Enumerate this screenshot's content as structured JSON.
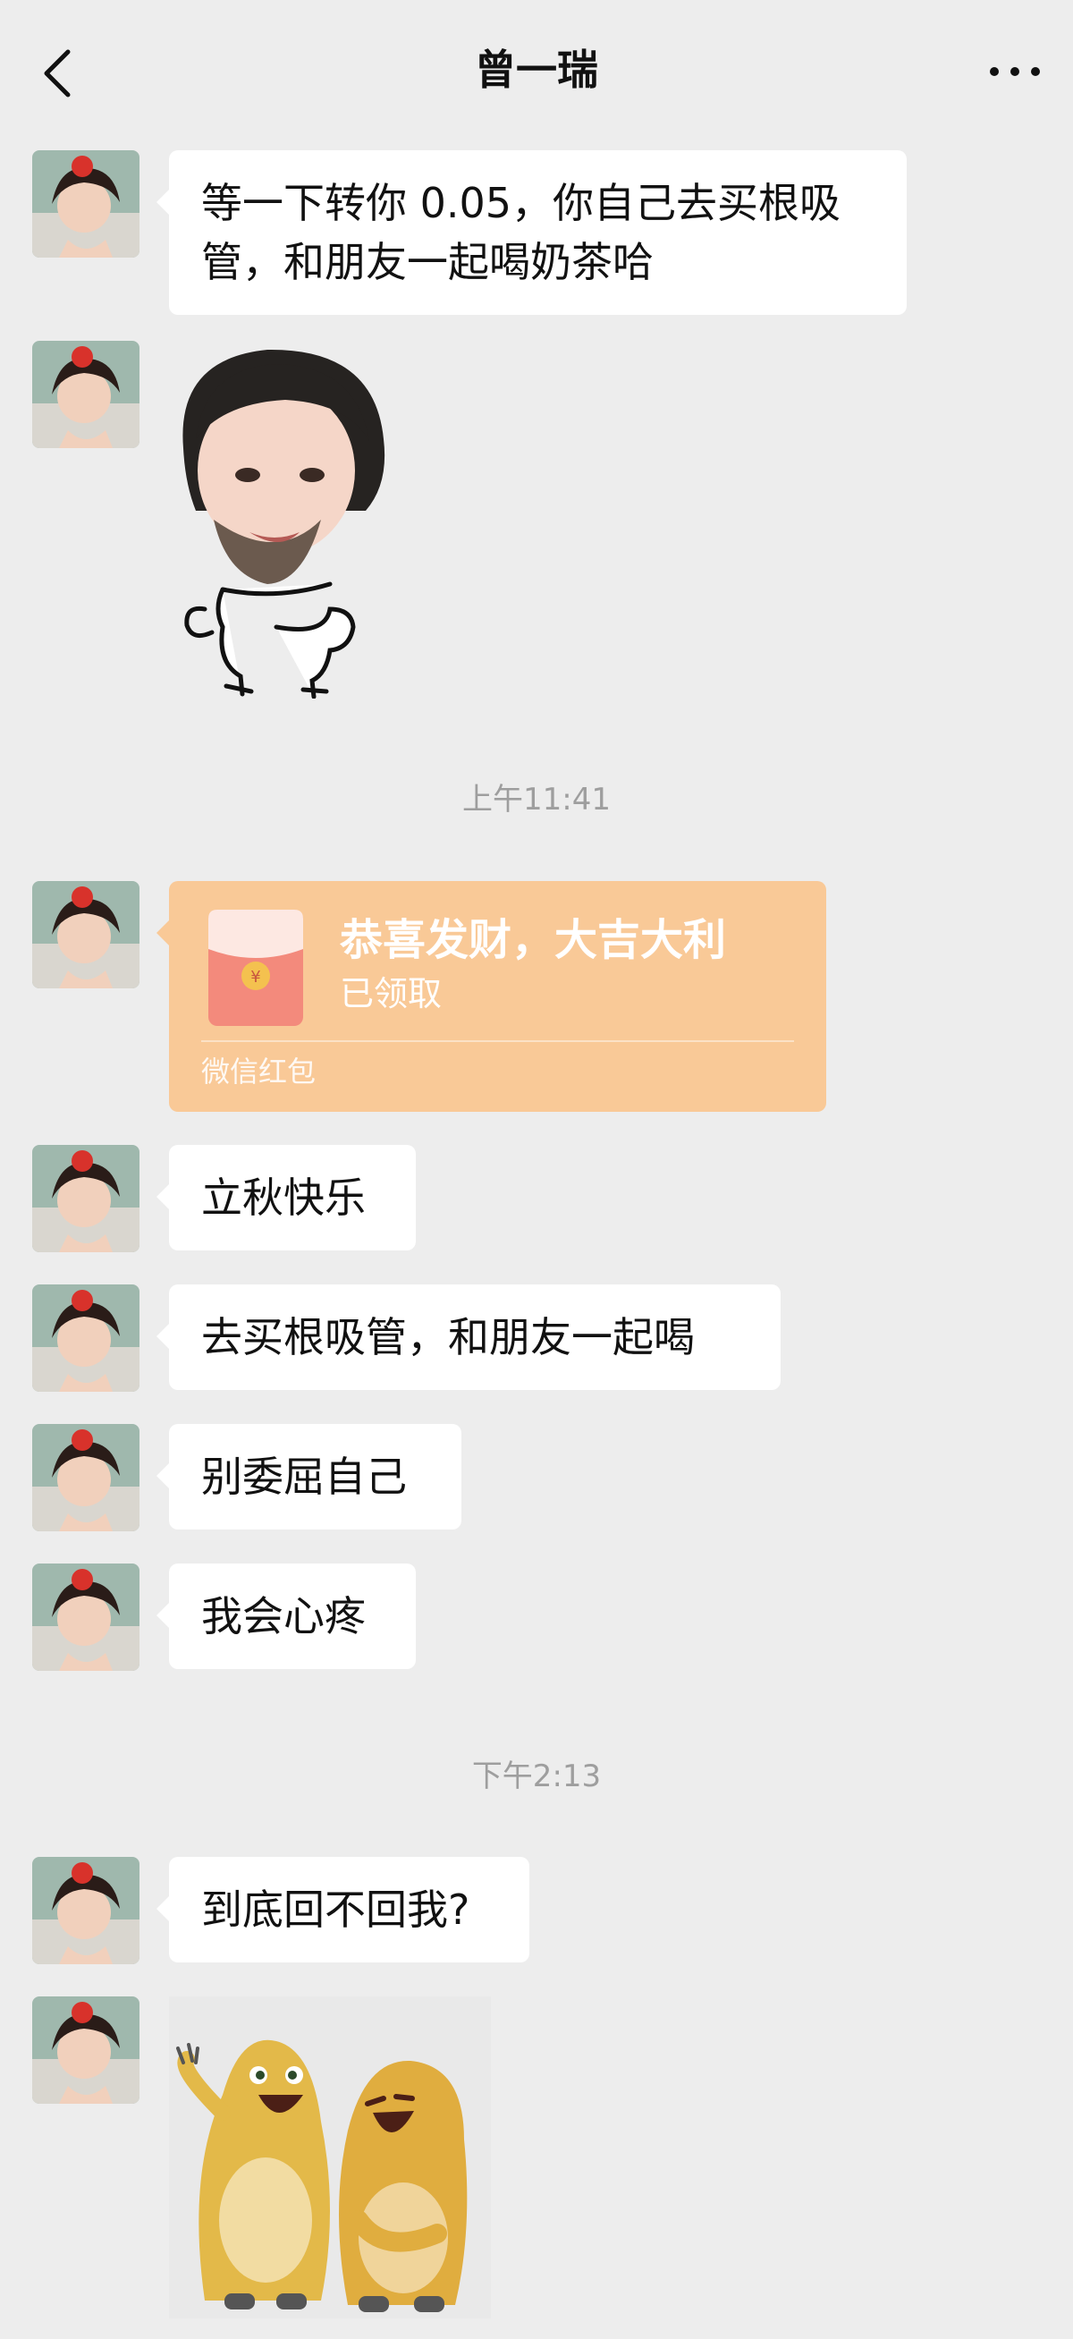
{
  "header": {
    "title": "曾一瑞",
    "back_icon": "chevron-left-icon",
    "more_icon": "more-horizontal-icon"
  },
  "messages": [
    {
      "type": "text",
      "text": "等一下转你 0.05，你自己去买根吸\n管，和朋友一起喝奶茶哈"
    },
    {
      "type": "sticker",
      "description_icon": "man-face-sticker-icon"
    },
    {
      "type": "time",
      "text": "上午11:41"
    },
    {
      "type": "red_packet",
      "title": "恭喜发财，大吉大利",
      "status": "已领取",
      "label": "微信红包"
    },
    {
      "type": "text",
      "text": "立秋快乐"
    },
    {
      "type": "text",
      "text": "去买根吸管，和朋友一起喝"
    },
    {
      "type": "text",
      "text": "别委屈自己"
    },
    {
      "type": "text",
      "text": "我会心疼"
    },
    {
      "type": "time",
      "text": "下午2:13"
    },
    {
      "type": "text",
      "text": "到底回不回我?"
    },
    {
      "type": "sticker",
      "description_icon": "laughing-creatures-sticker-icon"
    }
  ],
  "colors": {
    "background": "#ededed",
    "bubble": "#ffffff",
    "red_packet": "#f9c997",
    "timestamp": "#9e9e9e"
  }
}
